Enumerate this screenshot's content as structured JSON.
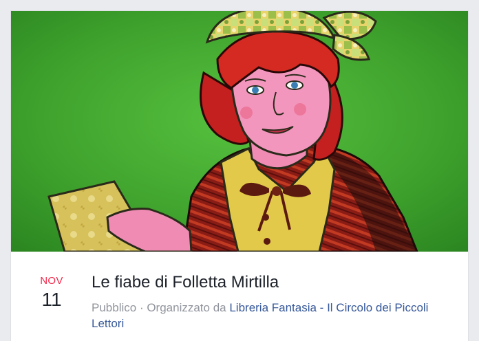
{
  "event": {
    "month": "NOV",
    "day": "11",
    "title": "Le fiabe di Folletta Mirtilla",
    "privacy": "Pubblico",
    "separator": " · ",
    "organized_by": "Organizzato da ",
    "organizer": "Libreria Fantasia - Il Circolo dei Piccoli Lettori"
  },
  "colors": {
    "background": "#e9ebee",
    "month_red": "#f02849",
    "link_blue": "#365899",
    "meta_grey": "#90949c",
    "title_dark": "#1d2129",
    "cover_green": "#3ea12c"
  },
  "cover": {
    "icon": "illustration-fairy-storyteller"
  }
}
